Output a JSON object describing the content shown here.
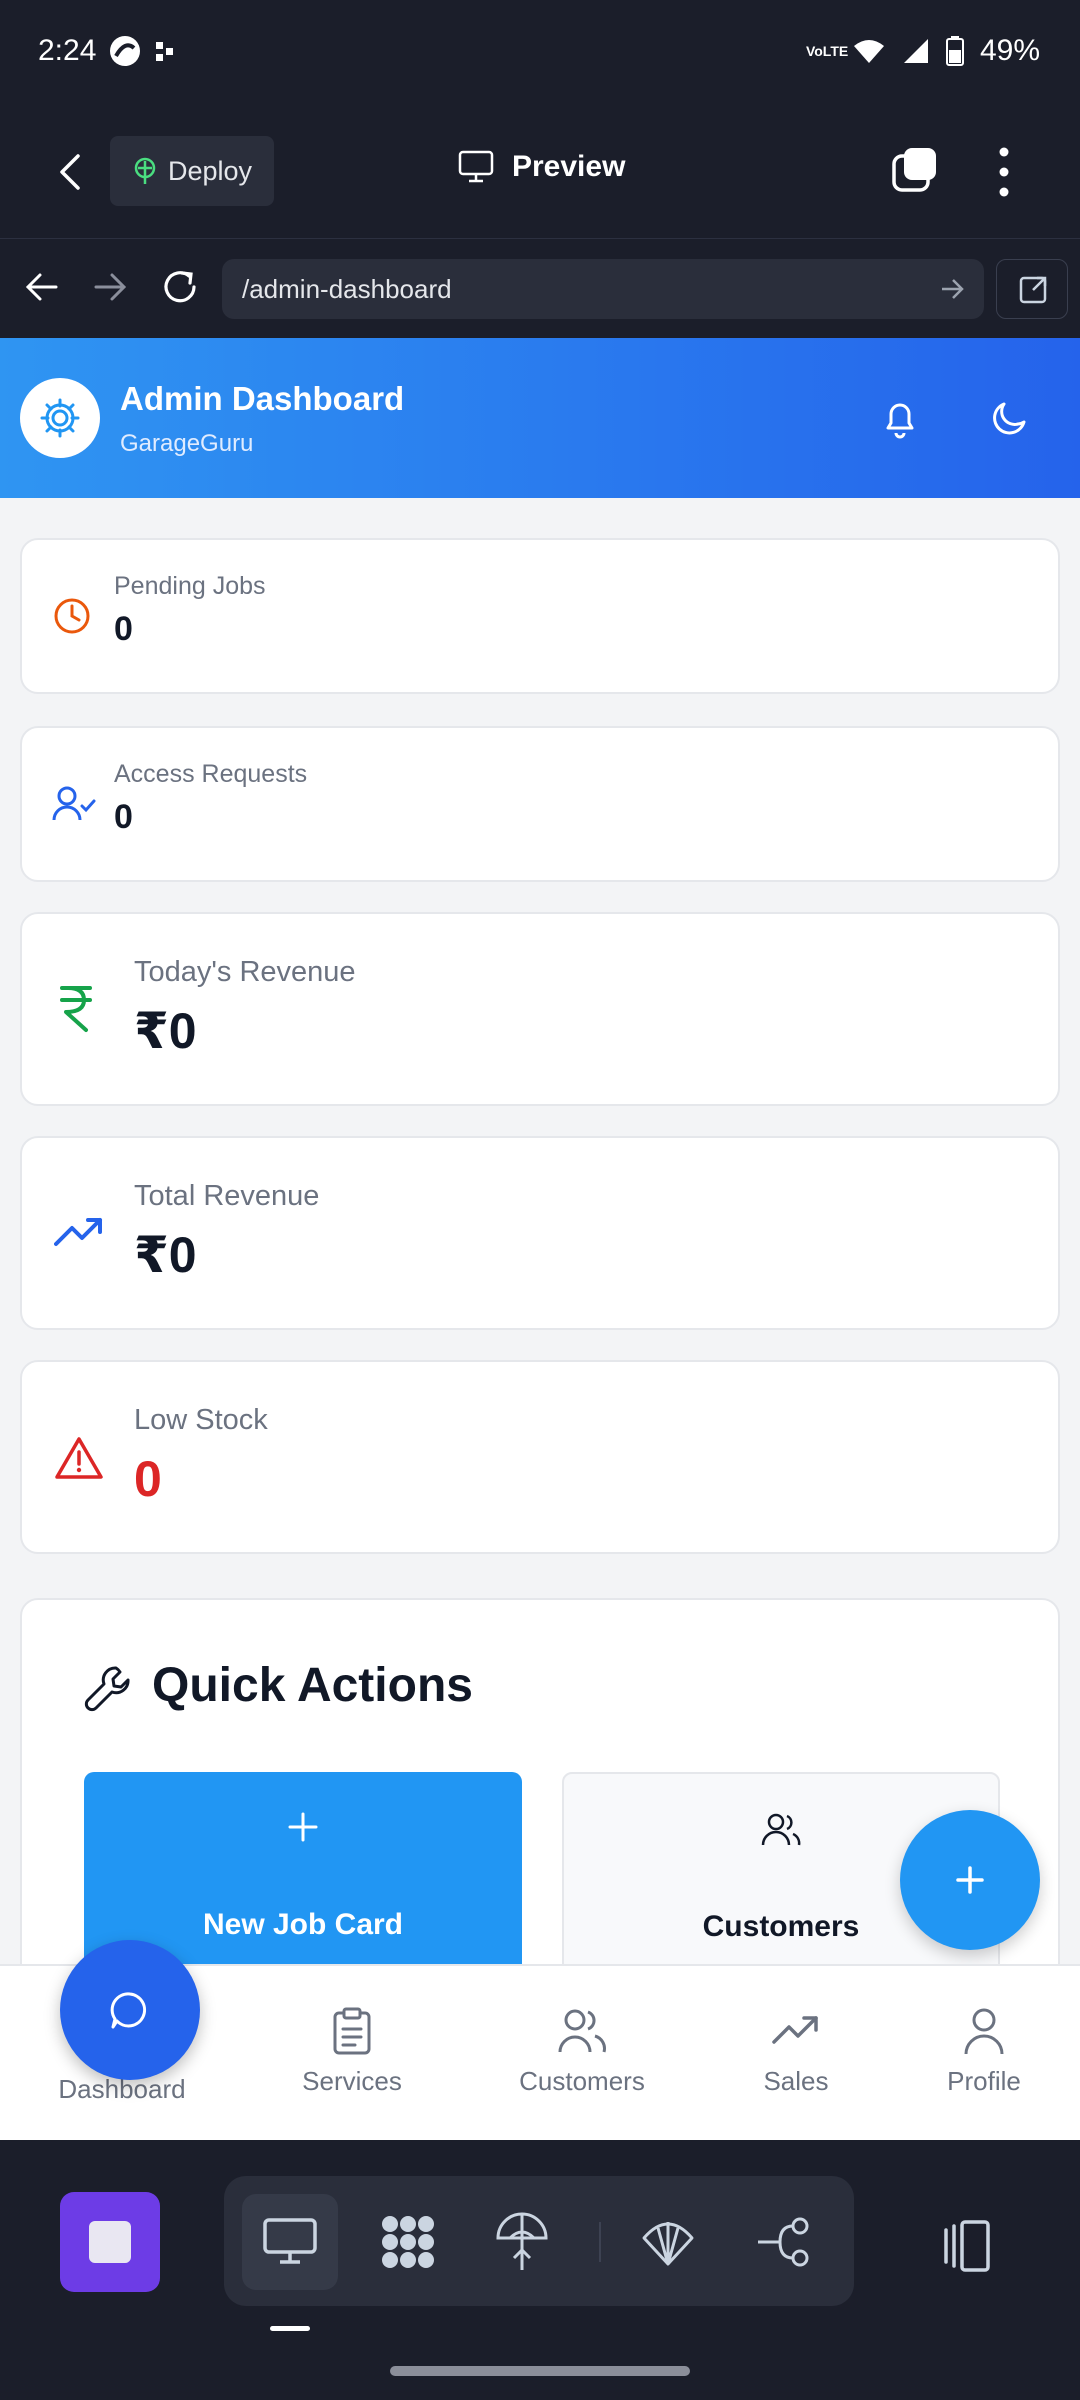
{
  "status": {
    "time": "2:24",
    "battery": "49%",
    "network": "VoLTE"
  },
  "browser": {
    "deploy_label": "Deploy",
    "preview_label": "Preview",
    "url": "/admin-dashboard"
  },
  "header": {
    "title": "Admin Dashboard",
    "subtitle": "GarageGuru"
  },
  "stats": [
    {
      "label": "Pending Jobs",
      "value": "0",
      "icon": "clock-icon",
      "color": "#ea580c"
    },
    {
      "label": "Access Requests",
      "value": "0",
      "icon": "user-check-icon",
      "color": "#2563eb"
    },
    {
      "label": "Today's Revenue",
      "value": "₹0",
      "icon": "rupee-icon",
      "color": "#16a34a"
    },
    {
      "label": "Total Revenue",
      "value": "₹0",
      "icon": "trending-up-icon",
      "color": "#2563eb"
    },
    {
      "label": "Low Stock",
      "value": "0",
      "icon": "alert-triangle-icon",
      "color": "#dc2626"
    }
  ],
  "quick_actions": {
    "title": "Quick Actions",
    "buttons": [
      {
        "label": "New Job Card"
      },
      {
        "label": "Customers"
      }
    ]
  },
  "bottom_nav": [
    {
      "label": "Dashboard"
    },
    {
      "label": "Services"
    },
    {
      "label": "Customers"
    },
    {
      "label": "Sales"
    },
    {
      "label": "Profile"
    }
  ],
  "colors": {
    "primary": "#2196f3",
    "header_start": "#2f95f2",
    "header_end": "#2563eb",
    "dark_chrome": "#1b1e2a"
  }
}
